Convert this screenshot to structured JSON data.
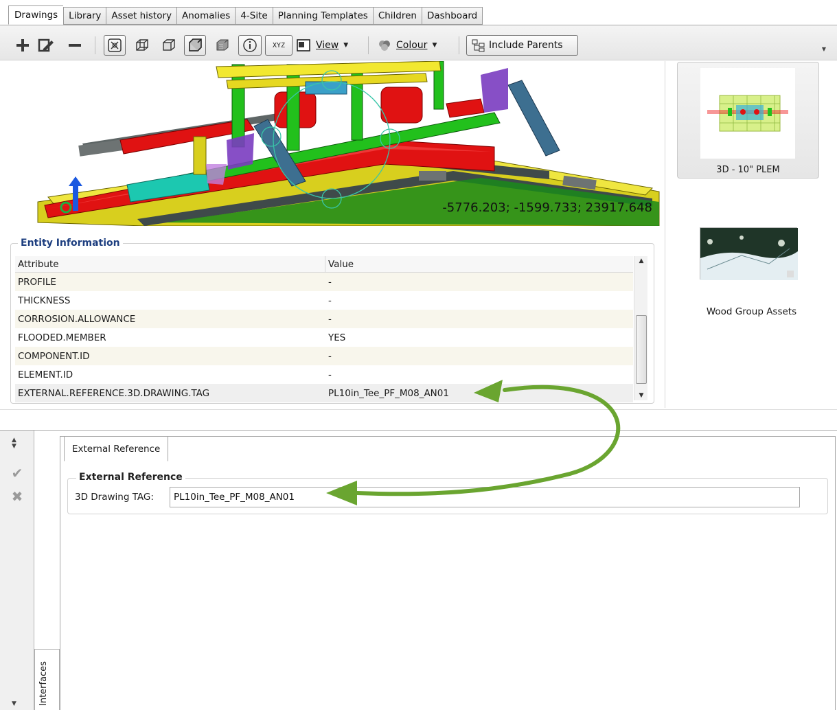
{
  "tabs": [
    {
      "label": "Drawings",
      "active": true
    },
    {
      "label": "Library"
    },
    {
      "label": "Asset history"
    },
    {
      "label": "Anomalies"
    },
    {
      "label": "4-Site"
    },
    {
      "label": "Planning Templates"
    },
    {
      "label": "Children"
    },
    {
      "label": "Dashboard"
    }
  ],
  "toolbar": {
    "add_icon": "plus-icon",
    "edit_icon": "edit-icon",
    "remove_icon": "minus-icon",
    "view_label": "View",
    "colour_label": "Colour",
    "include_parents_label": "Include Parents",
    "xyz_label": "XYZ"
  },
  "viewport": {
    "coordinates": "-5776.203; -1599.733; 23917.648"
  },
  "thumbnails": [
    {
      "caption": "3D - 10\" PLEM",
      "selected": true
    },
    {
      "caption": "Wood Group Assets",
      "selected": false
    }
  ],
  "entity_info": {
    "title": "Entity Information",
    "columns": [
      "Attribute",
      "Value"
    ],
    "rows": [
      {
        "attribute": "PROFILE",
        "value": "-"
      },
      {
        "attribute": "THICKNESS",
        "value": "-"
      },
      {
        "attribute": "CORROSION.ALLOWANCE",
        "value": "-"
      },
      {
        "attribute": "FLOODED.MEMBER",
        "value": "YES"
      },
      {
        "attribute": "COMPONENT.ID",
        "value": "-"
      },
      {
        "attribute": "ELEMENT.ID",
        "value": "-"
      },
      {
        "attribute": "EXTERNAL.REFERENCE.3D.DRAWING.TAG",
        "value": "PL10in_Tee_PF_M08_AN01"
      }
    ]
  },
  "editor": {
    "tab_label": "External Reference",
    "group_title": "External Reference",
    "field_label": "3D Drawing TAG:",
    "field_value": "PL10in_Tee_PF_M08_AN01",
    "side_tab_label": "Interfaces"
  },
  "colors": {
    "group_title_blue": "#1e3f80",
    "annotation_arrow_green": "#6aa530"
  }
}
